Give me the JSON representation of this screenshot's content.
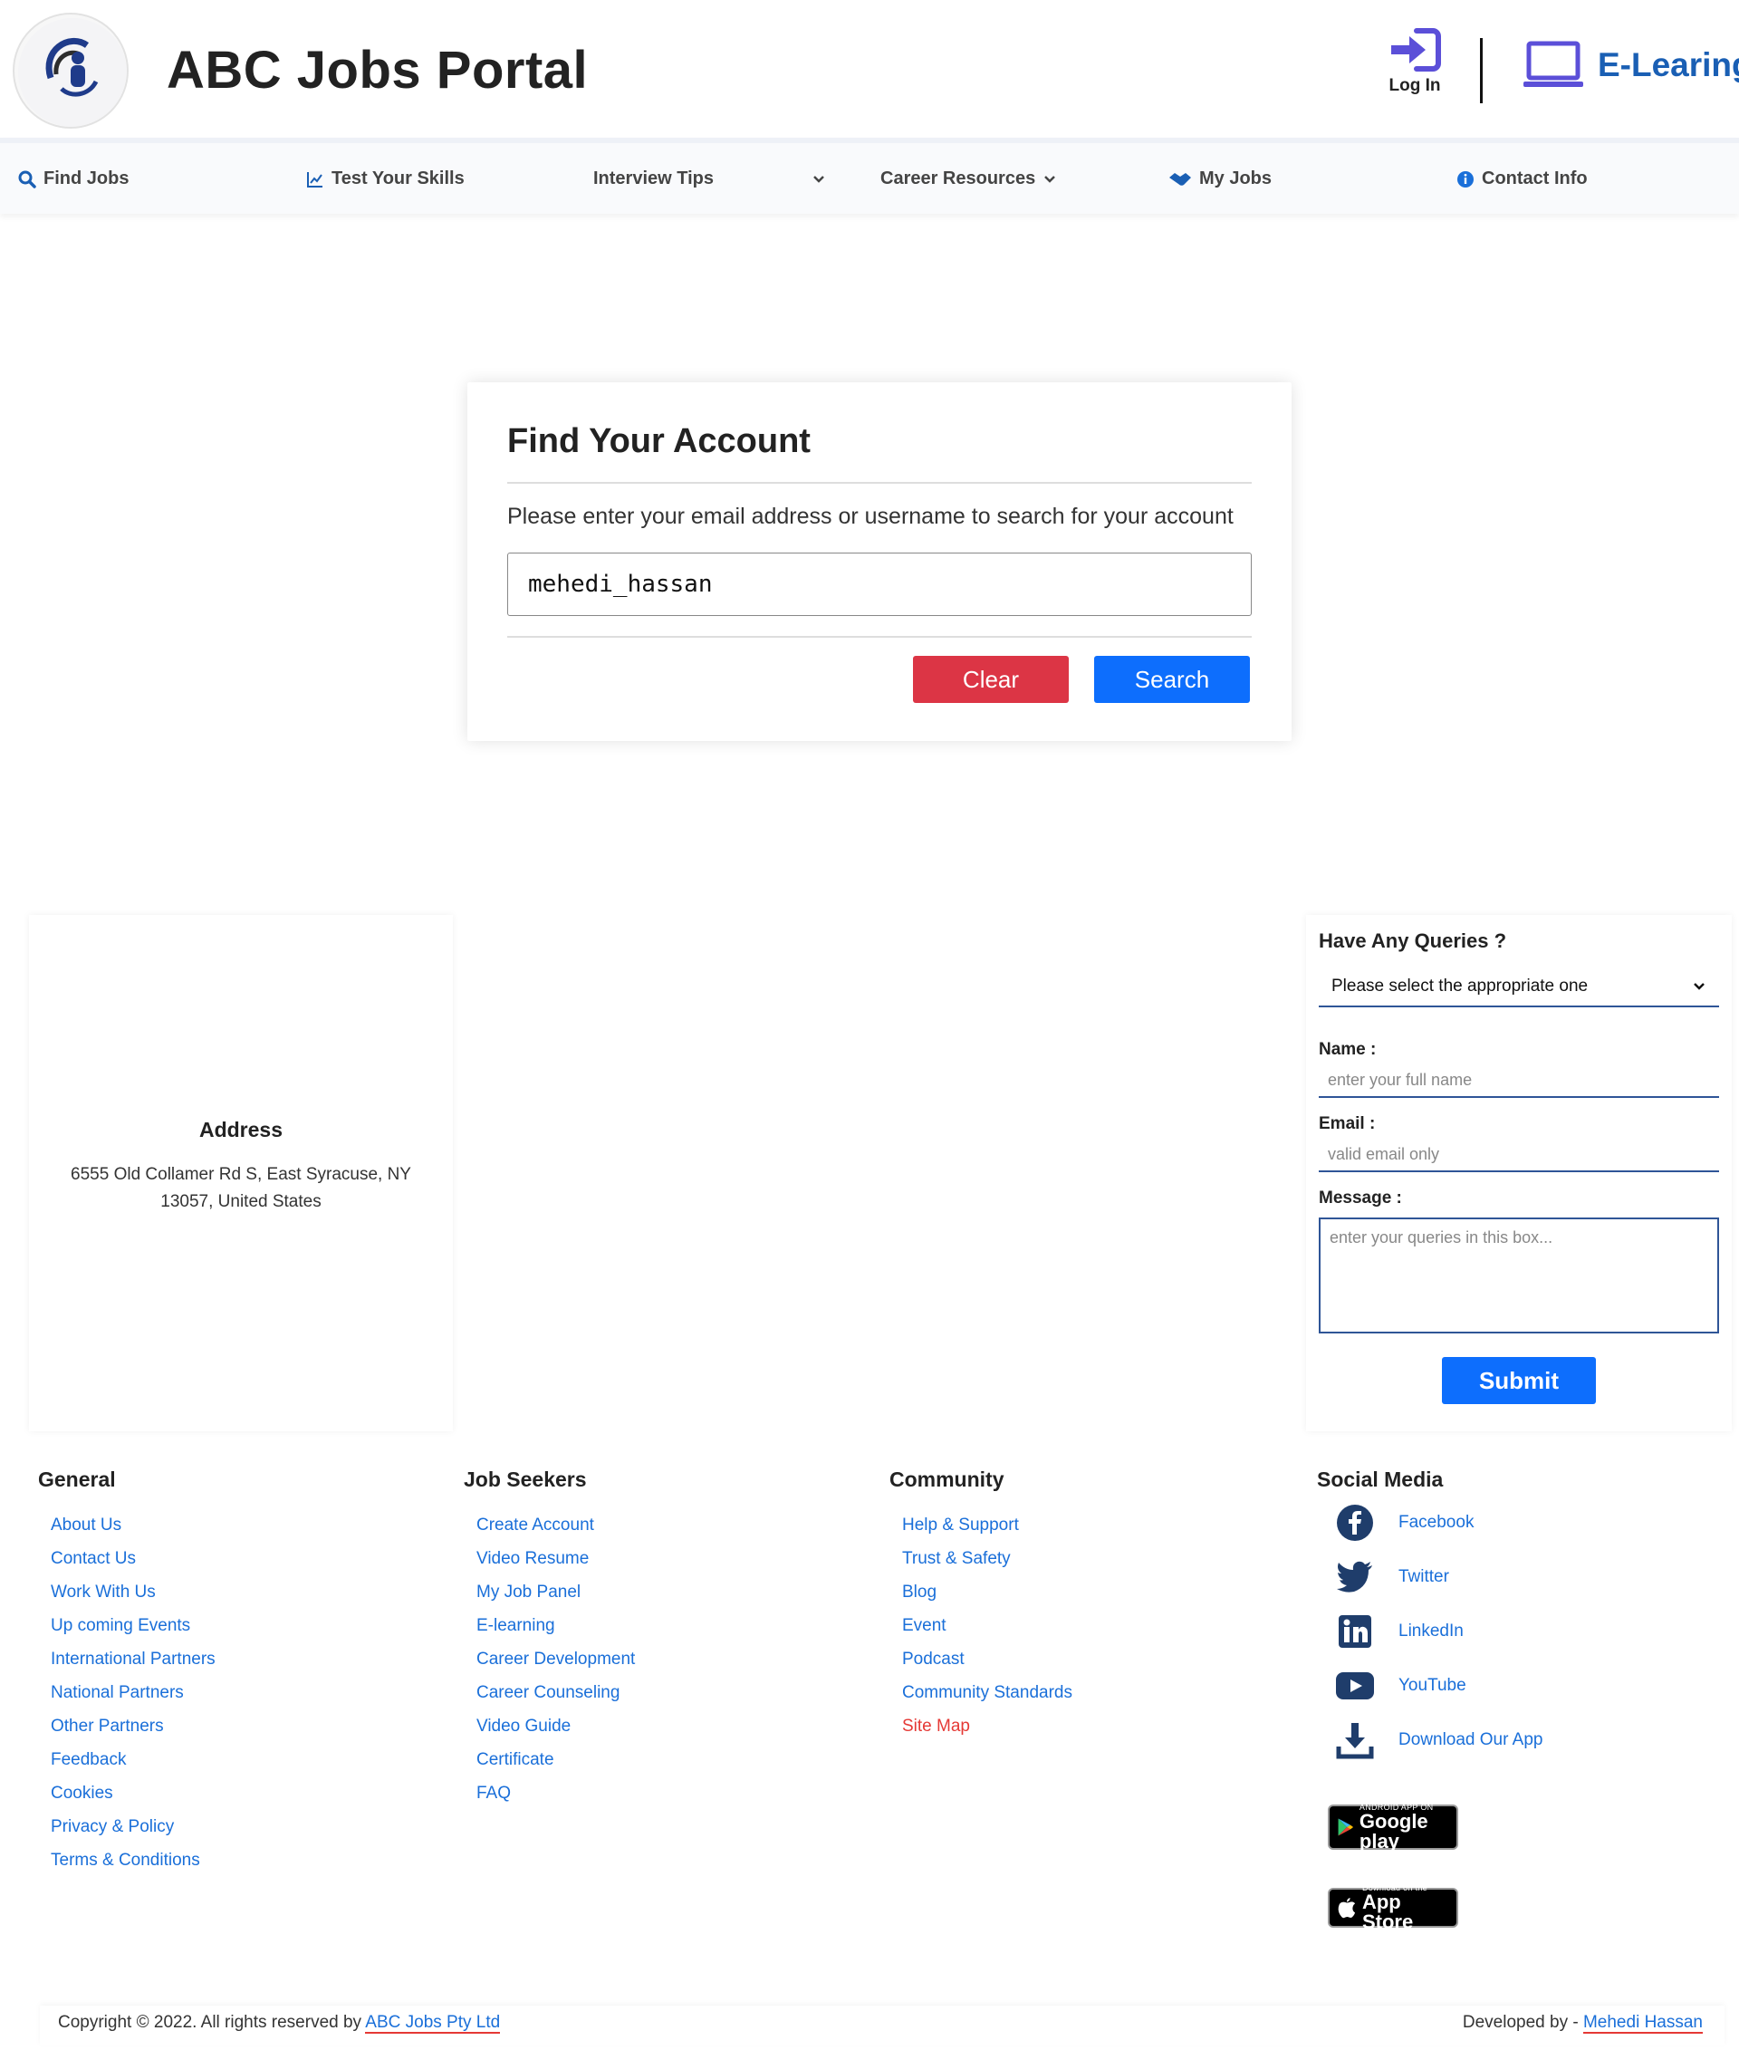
{
  "header": {
    "site_title": "ABC Jobs Portal",
    "logo_text": "ABC Jobs Portal",
    "login_label": "Log In",
    "elearning_label": "E-Learing"
  },
  "nav": {
    "items": [
      {
        "label": "Find Jobs",
        "icon": "search-icon"
      },
      {
        "label": "Test Your Skills",
        "icon": "chart-line-icon"
      },
      {
        "label": "Interview Tips",
        "icon": "chevron-down-icon"
      },
      {
        "label": "Career Resources",
        "icon": "chevron-down-icon"
      },
      {
        "label": "My Jobs",
        "icon": "handshake-icon"
      },
      {
        "label": "Contact Info",
        "icon": "info-icon"
      }
    ]
  },
  "find_account": {
    "title": "Find Your Account",
    "description": "Please enter your email address or username to search for your account",
    "input_value": "mehedi_hassan",
    "clear_label": "Clear",
    "search_label": "Search"
  },
  "address": {
    "title": "Address",
    "text": "6555 Old Collamer Rd S, East Syracuse, NY 13057, United States"
  },
  "queries": {
    "title": "Have Any Queries ?",
    "select_value": "Please select the appropriate one",
    "name_label": "Name :",
    "name_placeholder": "enter your full name",
    "email_label": "Email :",
    "email_placeholder": "valid email only",
    "message_label": "Message :",
    "message_placeholder": "enter your queries in this box...",
    "submit_label": "Submit"
  },
  "footer": {
    "general": {
      "heading": "General",
      "links": [
        "About Us",
        "Contact Us",
        "Work With Us",
        "Up coming Events",
        "International Partners",
        "National Partners",
        "Other Partners",
        "Feedback",
        "Cookies",
        "Privacy & Policy",
        "Terms & Conditions"
      ]
    },
    "job_seekers": {
      "heading": "Job Seekers",
      "links": [
        "Create Account",
        "Video Resume",
        "My Job Panel",
        "E-learning",
        "Career Development",
        "Career Counseling",
        "Video Guide",
        "Certificate",
        "FAQ"
      ]
    },
    "community": {
      "heading": "Community",
      "links": [
        "Help & Support",
        "Trust & Safety",
        "Blog",
        "Event",
        "Podcast",
        "Community Standards",
        "Site Map"
      ]
    },
    "social": {
      "heading": "Social Media",
      "links": [
        "Facebook",
        "Twitter",
        "LinkedIn",
        "YouTube",
        "Download Our App"
      ]
    },
    "google_play": {
      "small": "ANDROID APP ON",
      "big": "Google play"
    },
    "app_store": {
      "small": "Download on the",
      "big": "App Store"
    }
  },
  "copyright": {
    "text": "Copyright © 2022. All rights reserved by",
    "company": "ABC Jobs Pty Ltd",
    "developed_by": "Developed by -",
    "developer": "Mehedi Hassan"
  },
  "colors": {
    "primary": "#0d6efd",
    "danger": "#dc3545",
    "link": "#1a6fd9",
    "nav_icon": "#1a5fb4",
    "login_icon": "#5b4fd8"
  }
}
